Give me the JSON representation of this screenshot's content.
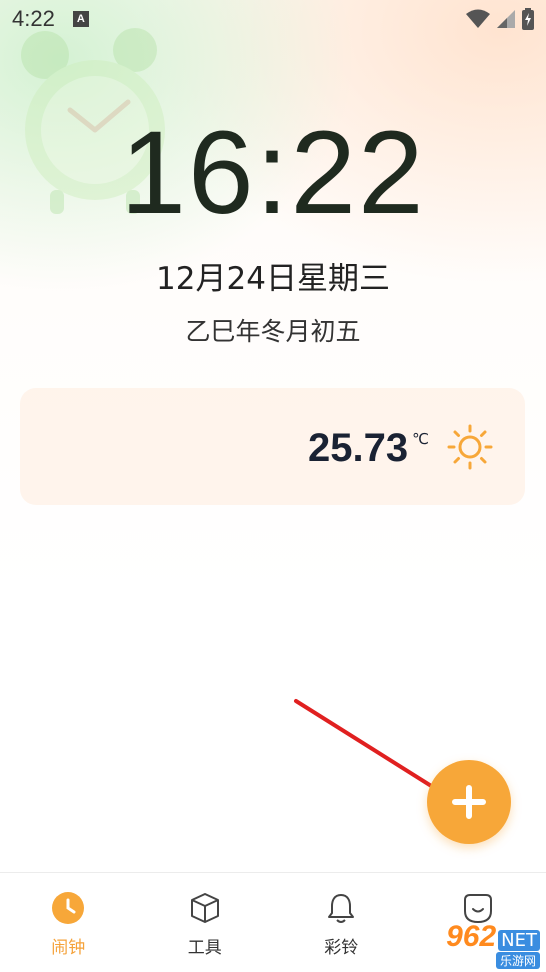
{
  "status_bar": {
    "time": "4:22",
    "notification_icon": "A"
  },
  "main": {
    "time": "16:22",
    "date": "12月24日星期三",
    "lunar_date": "乙巳年冬月初五"
  },
  "weather": {
    "temperature": "25.73",
    "unit": "℃",
    "icon": "sun-icon"
  },
  "fab": {
    "icon": "plus-icon"
  },
  "bottom_nav": {
    "items": [
      {
        "label": "闹钟",
        "icon": "clock-icon",
        "active": true
      },
      {
        "label": "工具",
        "icon": "box-icon",
        "active": false
      },
      {
        "label": "彩铃",
        "icon": "bell-icon",
        "active": false
      },
      {
        "label": "",
        "icon": "face-icon",
        "active": false
      }
    ]
  },
  "watermark": {
    "brand": "962",
    "suffix": "NET",
    "tagline": "乐游网"
  },
  "colors": {
    "accent": "#f7a739",
    "active_tab": "#f5a23a",
    "temperature_text": "#1a2233"
  }
}
